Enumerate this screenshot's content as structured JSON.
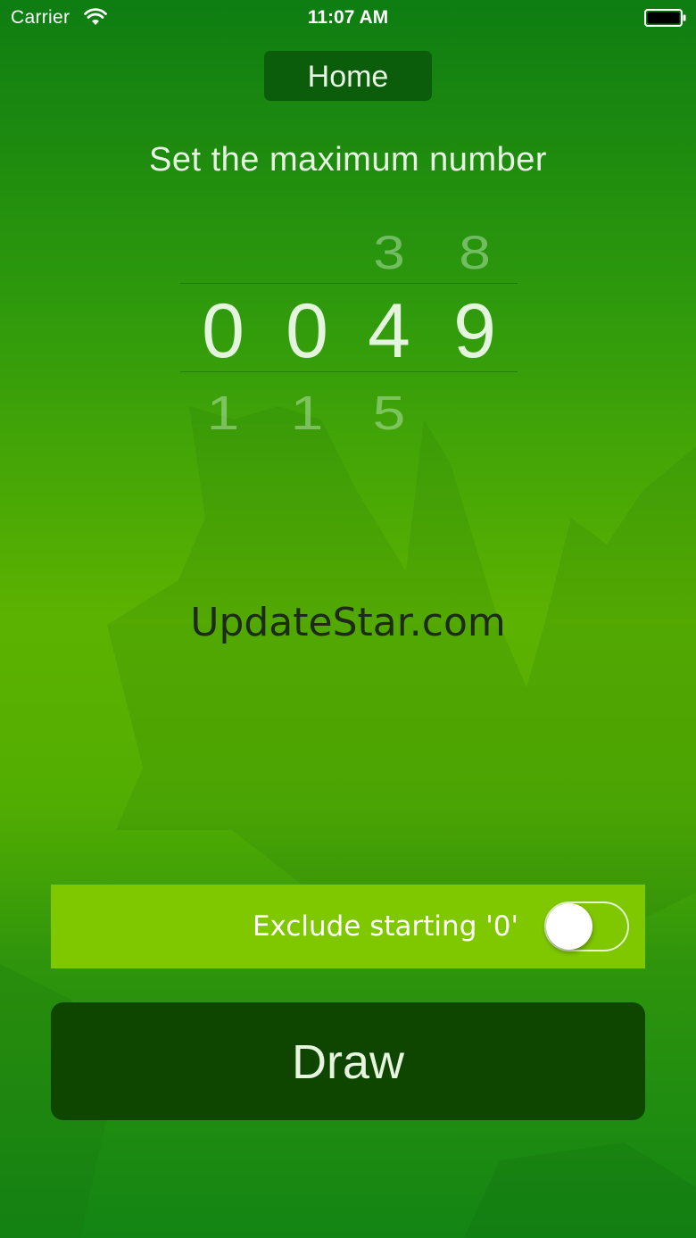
{
  "status_bar": {
    "carrier": "Carrier",
    "time": "11:07 AM",
    "wifi_icon": "wifi-icon",
    "battery_icon": "battery-full-icon"
  },
  "nav": {
    "home_label": "Home"
  },
  "picker": {
    "title": "Set the maximum number",
    "columns": [
      {
        "above": "",
        "selected": "0",
        "below": "1"
      },
      {
        "above": "",
        "selected": "0",
        "below": "1"
      },
      {
        "above": "3",
        "selected": "4",
        "below": "5"
      },
      {
        "above": "8",
        "selected": "9",
        "below": ""
      }
    ]
  },
  "watermark": "UpdateStar.com",
  "exclude": {
    "label": "Exclude starting '0'",
    "enabled": false
  },
  "actions": {
    "draw_label": "Draw"
  },
  "colors": {
    "background_top": "#0e7d12",
    "background_mid": "#5cb200",
    "home_button": "#0b5d0b",
    "exclude_row": "#7fc800",
    "draw_button": "#0e4600"
  }
}
